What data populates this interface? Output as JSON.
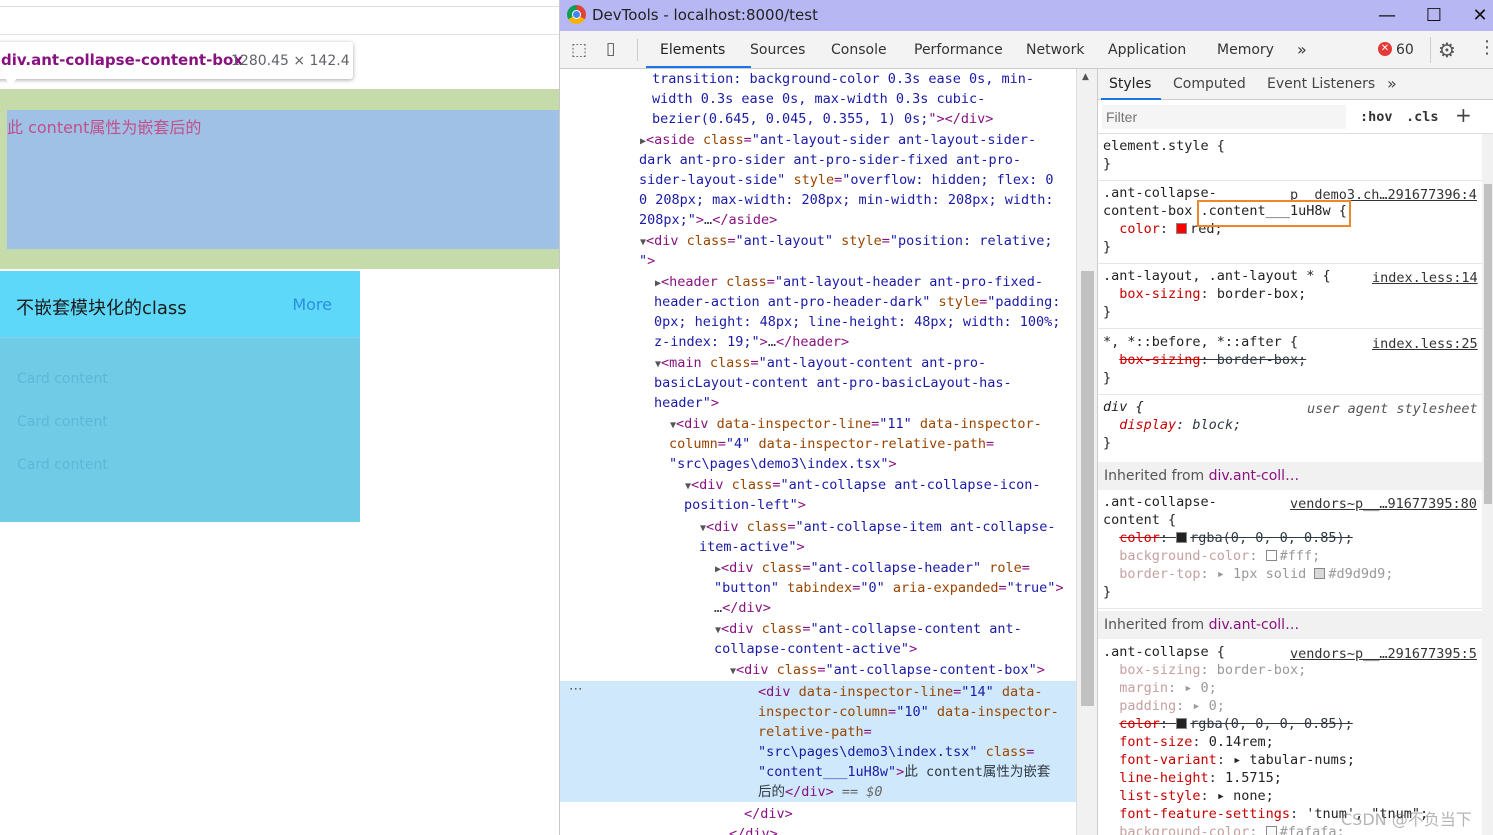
{
  "page": {
    "tooltip": {
      "element": "div.ant-collapse-content-box",
      "dimensions": "1280.45 × 142.4"
    },
    "content_text": "此 content属性为嵌套后的",
    "card": {
      "title": "不嵌套模块化的class",
      "more": "More",
      "lines": [
        "Card content",
        "Card content",
        "Card content"
      ]
    }
  },
  "devtools": {
    "title": "DevTools - localhost:8000/test",
    "tabs": [
      "Elements",
      "Sources",
      "Console",
      "Performance",
      "Network",
      "Application",
      "Memory"
    ],
    "active_tab": "Elements",
    "error_count": "60",
    "styles_tabs": [
      "Styles",
      "Computed",
      "Event Listeners"
    ],
    "filter_placeholder": "Filter",
    "hov": ":hov",
    "cls": ".cls",
    "inherited_1": "Inherited from",
    "inherited_1_el": "div.ant-coll…",
    "inherited_2": "Inherited from",
    "inherited_2_el": "div.ant-coll…",
    "sel_marker": "== $0",
    "ellipsis": "…"
  },
  "watermark": "CSDN @不负当下",
  "colors": {
    "accent": "#1a73e8",
    "titlebar": "#b7b8f3",
    "highlight_box": "#f0862b",
    "red_swatch": "#ff0000"
  }
}
